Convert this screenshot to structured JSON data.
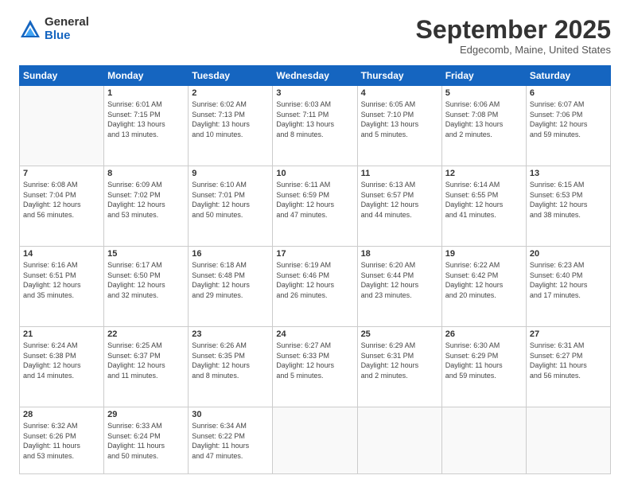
{
  "header": {
    "logo_general": "General",
    "logo_blue": "Blue",
    "month_title": "September 2025",
    "location": "Edgecomb, Maine, United States"
  },
  "weekdays": [
    "Sunday",
    "Monday",
    "Tuesday",
    "Wednesday",
    "Thursday",
    "Friday",
    "Saturday"
  ],
  "weeks": [
    [
      {
        "day": "",
        "content": ""
      },
      {
        "day": "1",
        "content": "Sunrise: 6:01 AM\nSunset: 7:15 PM\nDaylight: 13 hours\nand 13 minutes."
      },
      {
        "day": "2",
        "content": "Sunrise: 6:02 AM\nSunset: 7:13 PM\nDaylight: 13 hours\nand 10 minutes."
      },
      {
        "day": "3",
        "content": "Sunrise: 6:03 AM\nSunset: 7:11 PM\nDaylight: 13 hours\nand 8 minutes."
      },
      {
        "day": "4",
        "content": "Sunrise: 6:05 AM\nSunset: 7:10 PM\nDaylight: 13 hours\nand 5 minutes."
      },
      {
        "day": "5",
        "content": "Sunrise: 6:06 AM\nSunset: 7:08 PM\nDaylight: 13 hours\nand 2 minutes."
      },
      {
        "day": "6",
        "content": "Sunrise: 6:07 AM\nSunset: 7:06 PM\nDaylight: 12 hours\nand 59 minutes."
      }
    ],
    [
      {
        "day": "7",
        "content": "Sunrise: 6:08 AM\nSunset: 7:04 PM\nDaylight: 12 hours\nand 56 minutes."
      },
      {
        "day": "8",
        "content": "Sunrise: 6:09 AM\nSunset: 7:02 PM\nDaylight: 12 hours\nand 53 minutes."
      },
      {
        "day": "9",
        "content": "Sunrise: 6:10 AM\nSunset: 7:01 PM\nDaylight: 12 hours\nand 50 minutes."
      },
      {
        "day": "10",
        "content": "Sunrise: 6:11 AM\nSunset: 6:59 PM\nDaylight: 12 hours\nand 47 minutes."
      },
      {
        "day": "11",
        "content": "Sunrise: 6:13 AM\nSunset: 6:57 PM\nDaylight: 12 hours\nand 44 minutes."
      },
      {
        "day": "12",
        "content": "Sunrise: 6:14 AM\nSunset: 6:55 PM\nDaylight: 12 hours\nand 41 minutes."
      },
      {
        "day": "13",
        "content": "Sunrise: 6:15 AM\nSunset: 6:53 PM\nDaylight: 12 hours\nand 38 minutes."
      }
    ],
    [
      {
        "day": "14",
        "content": "Sunrise: 6:16 AM\nSunset: 6:51 PM\nDaylight: 12 hours\nand 35 minutes."
      },
      {
        "day": "15",
        "content": "Sunrise: 6:17 AM\nSunset: 6:50 PM\nDaylight: 12 hours\nand 32 minutes."
      },
      {
        "day": "16",
        "content": "Sunrise: 6:18 AM\nSunset: 6:48 PM\nDaylight: 12 hours\nand 29 minutes."
      },
      {
        "day": "17",
        "content": "Sunrise: 6:19 AM\nSunset: 6:46 PM\nDaylight: 12 hours\nand 26 minutes."
      },
      {
        "day": "18",
        "content": "Sunrise: 6:20 AM\nSunset: 6:44 PM\nDaylight: 12 hours\nand 23 minutes."
      },
      {
        "day": "19",
        "content": "Sunrise: 6:22 AM\nSunset: 6:42 PM\nDaylight: 12 hours\nand 20 minutes."
      },
      {
        "day": "20",
        "content": "Sunrise: 6:23 AM\nSunset: 6:40 PM\nDaylight: 12 hours\nand 17 minutes."
      }
    ],
    [
      {
        "day": "21",
        "content": "Sunrise: 6:24 AM\nSunset: 6:38 PM\nDaylight: 12 hours\nand 14 minutes."
      },
      {
        "day": "22",
        "content": "Sunrise: 6:25 AM\nSunset: 6:37 PM\nDaylight: 12 hours\nand 11 minutes."
      },
      {
        "day": "23",
        "content": "Sunrise: 6:26 AM\nSunset: 6:35 PM\nDaylight: 12 hours\nand 8 minutes."
      },
      {
        "day": "24",
        "content": "Sunrise: 6:27 AM\nSunset: 6:33 PM\nDaylight: 12 hours\nand 5 minutes."
      },
      {
        "day": "25",
        "content": "Sunrise: 6:29 AM\nSunset: 6:31 PM\nDaylight: 12 hours\nand 2 minutes."
      },
      {
        "day": "26",
        "content": "Sunrise: 6:30 AM\nSunset: 6:29 PM\nDaylight: 11 hours\nand 59 minutes."
      },
      {
        "day": "27",
        "content": "Sunrise: 6:31 AM\nSunset: 6:27 PM\nDaylight: 11 hours\nand 56 minutes."
      }
    ],
    [
      {
        "day": "28",
        "content": "Sunrise: 6:32 AM\nSunset: 6:26 PM\nDaylight: 11 hours\nand 53 minutes."
      },
      {
        "day": "29",
        "content": "Sunrise: 6:33 AM\nSunset: 6:24 PM\nDaylight: 11 hours\nand 50 minutes."
      },
      {
        "day": "30",
        "content": "Sunrise: 6:34 AM\nSunset: 6:22 PM\nDaylight: 11 hours\nand 47 minutes."
      },
      {
        "day": "",
        "content": ""
      },
      {
        "day": "",
        "content": ""
      },
      {
        "day": "",
        "content": ""
      },
      {
        "day": "",
        "content": ""
      }
    ]
  ]
}
